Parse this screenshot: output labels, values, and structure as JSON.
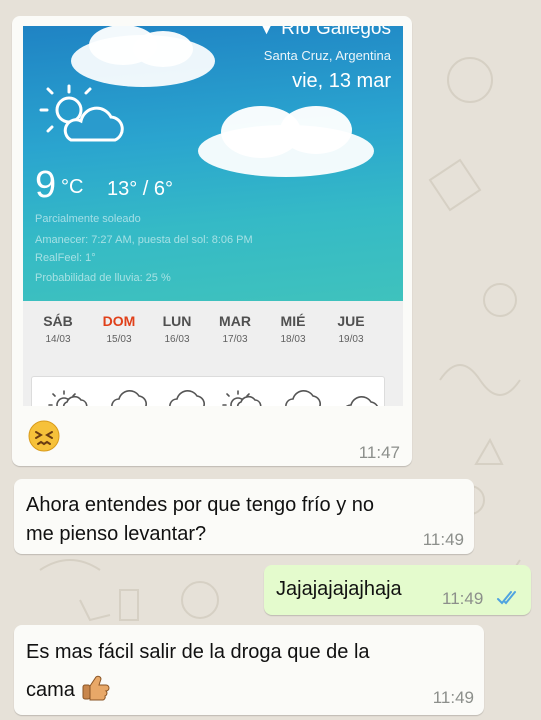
{
  "weather": {
    "city": "Río Gallegos",
    "region": "Santa Cruz, Argentina",
    "date": "vie, 13 mar",
    "temp": "9",
    "unit": "°C",
    "hi_lo": "13° / 6°",
    "condition": "Parcialmente soleado",
    "sun": "Amanecer: 7:27 AM, puesta del sol: 8:06 PM",
    "realfeel": "RealFeel: 1°",
    "rain": "Probabilidad de lluvia: 25 %",
    "forecast": [
      {
        "day": "SÁB",
        "date": "14/03",
        "icon": "partly-sunny-icon"
      },
      {
        "day": "DOM",
        "date": "15/03",
        "icon": "cloud-icon"
      },
      {
        "day": "LUN",
        "date": "16/03",
        "icon": "cloud-icon"
      },
      {
        "day": "MAR",
        "date": "17/03",
        "icon": "partly-sunny-icon"
      },
      {
        "day": "MIÉ",
        "date": "18/03",
        "icon": "cloud-icon"
      },
      {
        "day": "JUE",
        "date": "19/03",
        "icon": "cloud-icon"
      }
    ]
  },
  "messages": [
    {
      "kind": "image",
      "time": "11:47",
      "emoji": "persevering-face-icon"
    },
    {
      "kind": "text",
      "text_line1": "Ahora entendes por que tengo frío y no",
      "text_line2": "me pienso levantar?",
      "time": "11:49"
    },
    {
      "kind": "outgoing",
      "text": "Jajajajajajhaja",
      "time": "11:49",
      "status": "read-double-check-icon"
    },
    {
      "kind": "text",
      "text_line1": "Es mas fácil salir de la droga que de la",
      "text_line2": "cama",
      "time": "11:49",
      "emoji": "thumbs-up-icon"
    }
  ],
  "colors": {
    "incoming": "#fbfbf8",
    "outgoing": "#e4fbcd",
    "read_ticks": "#4fa3e0",
    "sunday": "#e0401a"
  }
}
